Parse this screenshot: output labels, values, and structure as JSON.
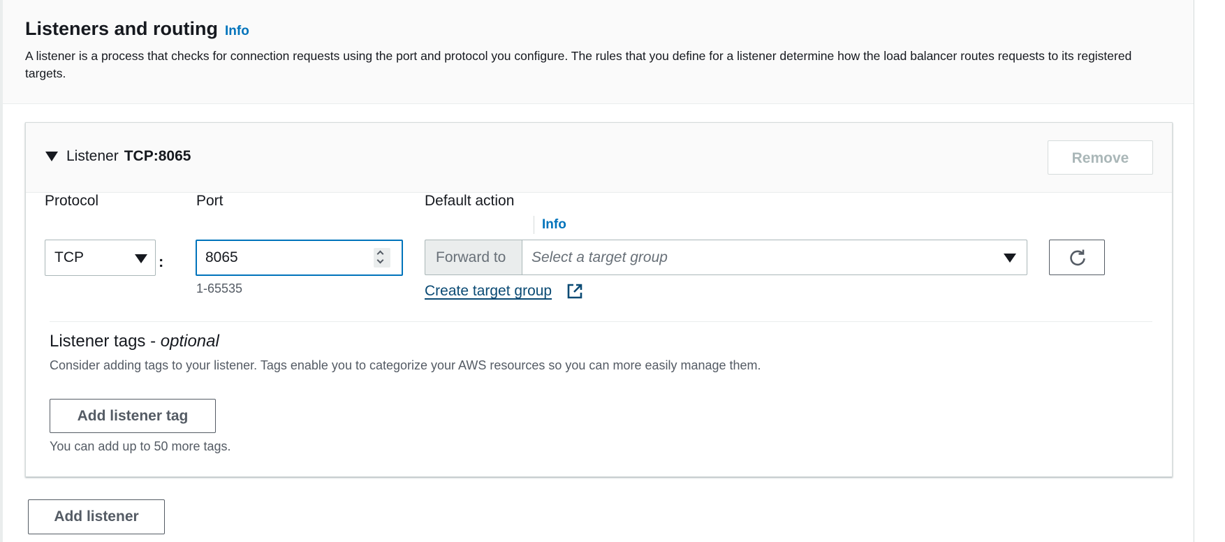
{
  "section": {
    "title": "Listeners and routing",
    "info_label": "Info",
    "description": "A listener is a process that checks for connection requests using the port and protocol you configure. The rules that you define for a listener determine how the load balancer routes requests to its registered targets."
  },
  "listener": {
    "label": "Listener",
    "name": "TCP:8065",
    "remove_label": "Remove",
    "protocol_label": "Protocol",
    "protocol_value": "TCP",
    "separator": ":",
    "port_label": "Port",
    "port_value": "8065",
    "port_hint": "1-65535",
    "default_action_label": "Default action",
    "default_action_info": "Info",
    "forward_to_label": "Forward to",
    "target_group_placeholder": "Select a target group",
    "create_target_group_label": "Create target group"
  },
  "tags": {
    "title_prefix": "Listener tags - ",
    "title_optional": "optional",
    "description": "Consider adding tags to your listener. Tags enable you to categorize your AWS resources so you can more easily manage them.",
    "add_tag_label": "Add listener tag",
    "limit_hint": "You can add up to 50 more tags."
  },
  "add_listener_label": "Add listener",
  "colors": {
    "link": "#0073bb",
    "link_dark": "#0a4a74",
    "focus_border": "#0073bb",
    "text": "#16191f",
    "secondary_text": "#545b64",
    "disabled_text": "#aab7b8"
  },
  "icons": {
    "expand": "caret-down-icon",
    "dropdown": "triangle-down-icon",
    "spinner": "number-stepper-icon",
    "external": "external-link-icon",
    "refresh": "refresh-icon"
  }
}
